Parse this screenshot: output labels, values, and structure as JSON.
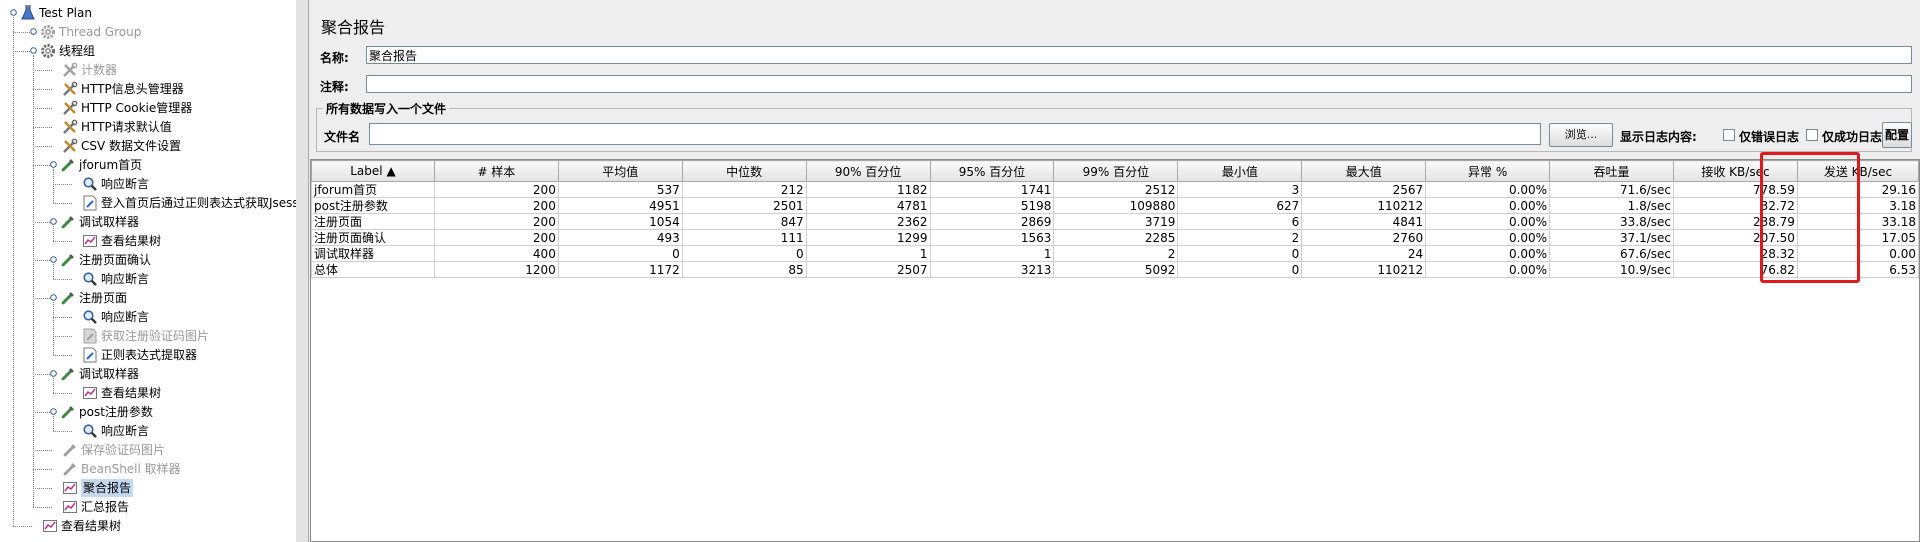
{
  "tree": {
    "items": [
      {
        "label": "Test Plan",
        "icon": "test-plan-icon",
        "disabled": false,
        "selected": false
      },
      {
        "label": "Thread Group",
        "icon": "gear-icon",
        "disabled": true,
        "selected": false
      },
      {
        "label": "线程组",
        "icon": "gear-icon",
        "disabled": false,
        "selected": false
      },
      {
        "label": "计数器",
        "icon": "config-tools-icon",
        "disabled": true,
        "selected": false
      },
      {
        "label": "HTTP信息头管理器",
        "icon": "config-tools-icon",
        "disabled": false,
        "selected": false
      },
      {
        "label": "HTTP Cookie管理器",
        "icon": "config-tools-icon",
        "disabled": false,
        "selected": false
      },
      {
        "label": "HTTP请求默认值",
        "icon": "config-tools-icon",
        "disabled": false,
        "selected": false
      },
      {
        "label": "CSV 数据文件设置",
        "icon": "config-tools-icon",
        "disabled": false,
        "selected": false
      },
      {
        "label": "jforum首页",
        "icon": "sampler-pipette-icon",
        "disabled": false,
        "selected": false
      },
      {
        "label": "响应断言",
        "icon": "magnifier-icon",
        "disabled": false,
        "selected": false
      },
      {
        "label": "登入首页后通过正则表达式获取Jsessionid",
        "icon": "extractor-icon",
        "disabled": false,
        "selected": false
      },
      {
        "label": "调试取样器",
        "icon": "sampler-pipette-icon",
        "disabled": false,
        "selected": false
      },
      {
        "label": "查看结果树",
        "icon": "listener-chart-icon",
        "disabled": false,
        "selected": false
      },
      {
        "label": "注册页面确认",
        "icon": "sampler-pipette-icon",
        "disabled": false,
        "selected": false
      },
      {
        "label": "响应断言",
        "icon": "magnifier-icon",
        "disabled": false,
        "selected": false
      },
      {
        "label": "注册页面",
        "icon": "sampler-pipette-icon",
        "disabled": false,
        "selected": false
      },
      {
        "label": "响应断言",
        "icon": "magnifier-icon",
        "disabled": false,
        "selected": false
      },
      {
        "label": "获取注册验证码图片",
        "icon": "extractor-icon",
        "disabled": true,
        "selected": false
      },
      {
        "label": "正则表达式提取器",
        "icon": "extractor-icon",
        "disabled": false,
        "selected": false
      },
      {
        "label": "调试取样器",
        "icon": "sampler-pipette-icon",
        "disabled": false,
        "selected": false
      },
      {
        "label": "查看结果树",
        "icon": "listener-chart-icon",
        "disabled": false,
        "selected": false
      },
      {
        "label": "post注册参数",
        "icon": "sampler-pipette-icon",
        "disabled": false,
        "selected": false
      },
      {
        "label": "响应断言",
        "icon": "magnifier-icon",
        "disabled": false,
        "selected": false
      },
      {
        "label": "保存验证码图片",
        "icon": "sampler-pipette-icon",
        "disabled": true,
        "selected": false
      },
      {
        "label": "BeanShell 取样器",
        "icon": "sampler-pipette-icon",
        "disabled": true,
        "selected": false
      },
      {
        "label": "聚合报告",
        "icon": "listener-chart-icon",
        "disabled": false,
        "selected": true
      },
      {
        "label": "汇总报告",
        "icon": "listener-chart-icon",
        "disabled": false,
        "selected": false
      },
      {
        "label": "查看结果树",
        "icon": "listener-chart-icon",
        "disabled": false,
        "selected": false
      }
    ]
  },
  "panel": {
    "title": "聚合报告",
    "name_label": "名称:",
    "name_value": "聚合报告",
    "comment_label": "注释:",
    "comment_value": "",
    "file_group_title": "所有数据写入一个文件",
    "filename_label": "文件名",
    "filename_value": "",
    "browse_label": "浏览...",
    "log_label": "显示日志内容:",
    "errors_only_label": "仅错误日志",
    "success_only_label": "仅成功日志",
    "configure_label": "配置"
  },
  "table": {
    "columns": [
      "Label ▲",
      "# 样本",
      "平均值",
      "中位数",
      "90% 百分位",
      "95% 百分位",
      "99% 百分位",
      "最小值",
      "最大值",
      "异常 %",
      "吞吐量",
      "接收 KB/sec",
      "发送 KB/sec"
    ],
    "rows": [
      [
        "jforum首页",
        "200",
        "537",
        "212",
        "1182",
        "1741",
        "2512",
        "3",
        "2567",
        "0.00%",
        "71.6/sec",
        "778.59",
        "29.16"
      ],
      [
        "post注册参数",
        "200",
        "4951",
        "2501",
        "4781",
        "5198",
        "109880",
        "627",
        "110212",
        "0.00%",
        "1.8/sec",
        "32.72",
        "3.18"
      ],
      [
        "注册页面",
        "200",
        "1054",
        "847",
        "2362",
        "2869",
        "3719",
        "6",
        "4841",
        "0.00%",
        "33.8/sec",
        "238.79",
        "33.18"
      ],
      [
        "注册页面确认",
        "200",
        "493",
        "111",
        "1299",
        "1563",
        "2285",
        "2",
        "2760",
        "0.00%",
        "37.1/sec",
        "207.50",
        "17.05"
      ],
      [
        "调试取样器",
        "400",
        "0",
        "0",
        "1",
        "1",
        "2",
        "0",
        "24",
        "0.00%",
        "67.6/sec",
        "28.32",
        "0.00"
      ],
      [
        "总体",
        "1200",
        "1172",
        "85",
        "2507",
        "3213",
        "5092",
        "0",
        "110212",
        "0.00%",
        "10.9/sec",
        "76.82",
        "6.53"
      ]
    ]
  },
  "colors": {
    "highlight": "#e0191e",
    "selection": "#c4d9ee"
  }
}
